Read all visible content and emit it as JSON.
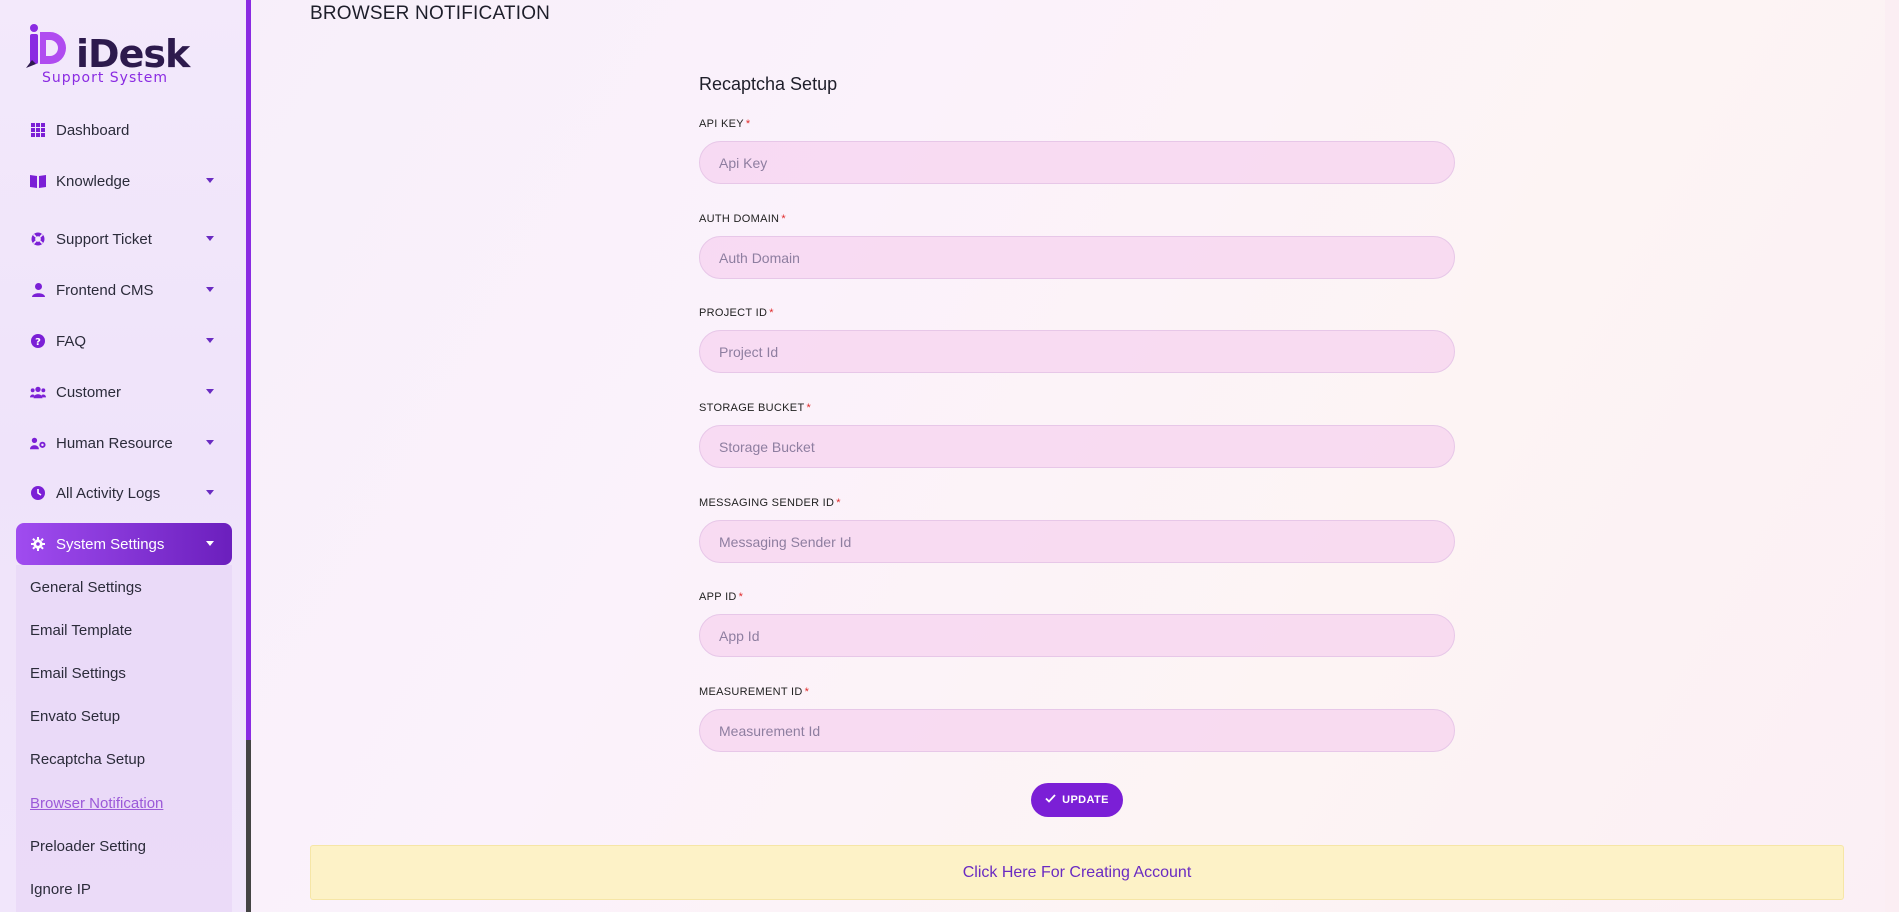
{
  "brand": {
    "name": "iDesk",
    "tagline": "Support System"
  },
  "sidebar": {
    "items": [
      {
        "label": "Dashboard",
        "icon": "grid-icon",
        "has_caret": false
      },
      {
        "label": "Knowledge",
        "icon": "book-icon",
        "has_caret": true
      },
      {
        "label": "Support Ticket",
        "icon": "lifebuoy-icon",
        "has_caret": true
      },
      {
        "label": "Frontend CMS",
        "icon": "user-icon",
        "has_caret": true
      },
      {
        "label": "FAQ",
        "icon": "question-icon",
        "has_caret": true
      },
      {
        "label": "Customer",
        "icon": "users-icon",
        "has_caret": true
      },
      {
        "label": "Human Resource",
        "icon": "user-gear-icon",
        "has_caret": true
      },
      {
        "label": "All Activity Logs",
        "icon": "clock-icon",
        "has_caret": true
      },
      {
        "label": "System Settings",
        "icon": "gear-icon",
        "has_caret": true,
        "active": true
      }
    ],
    "submenu": [
      {
        "label": "General Settings"
      },
      {
        "label": "Email Template"
      },
      {
        "label": "Email Settings"
      },
      {
        "label": "Envato Setup"
      },
      {
        "label": "Recaptcha Setup"
      },
      {
        "label": "Browser Notification",
        "current": true
      },
      {
        "label": "Preloader Setting"
      },
      {
        "label": "Ignore IP"
      }
    ]
  },
  "main": {
    "page_title": "BROWSER NOTIFICATION",
    "card_title": "Recaptcha Setup",
    "fields": [
      {
        "label": "API KEY",
        "placeholder": "Api Key",
        "value": ""
      },
      {
        "label": "AUTH DOMAIN",
        "placeholder": "Auth Domain",
        "value": ""
      },
      {
        "label": "PROJECT ID",
        "placeholder": "Project Id",
        "value": ""
      },
      {
        "label": "STORAGE BUCKET",
        "placeholder": "Storage Bucket",
        "value": ""
      },
      {
        "label": "MESSAGING SENDER ID",
        "placeholder": "Messaging Sender Id",
        "value": ""
      },
      {
        "label": "APP ID",
        "placeholder": "App Id",
        "value": ""
      },
      {
        "label": "MEASUREMENT ID",
        "placeholder": "Measurement Id",
        "value": ""
      }
    ],
    "required_mark": "*",
    "update_button": {
      "label": "UPDATE",
      "icon": "check-icon"
    },
    "notice_link": "Click Here For Creating Account"
  },
  "colors": {
    "accent": "#7b1fd6",
    "active_nav_start": "#a04cf0",
    "active_nav_end": "#6b1fbd",
    "required": "#e02b2b",
    "notice_bg": "#fdf2c7"
  }
}
